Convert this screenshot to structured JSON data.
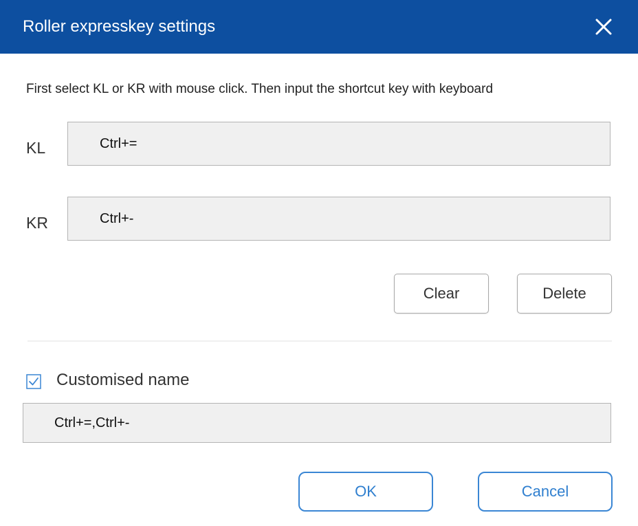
{
  "window": {
    "title": "Roller expresskey settings",
    "close_icon": "close-icon",
    "titlebar_color": "#0d4fa0"
  },
  "instruction": "First select KL or KR with mouse click. Then input the shortcut key with keyboard",
  "keys": {
    "kl_label": "KL",
    "kl_value": "Ctrl+=",
    "kr_label": "KR",
    "kr_value": "Ctrl+-"
  },
  "actions": {
    "clear_label": "Clear",
    "delete_label": "Delete"
  },
  "custom_name": {
    "checkbox_label": "Customised name",
    "checked": true,
    "value": "Ctrl+=,Ctrl+-",
    "accent_color": "#3a86d4"
  },
  "footer": {
    "ok_label": "OK",
    "cancel_label": "Cancel"
  }
}
